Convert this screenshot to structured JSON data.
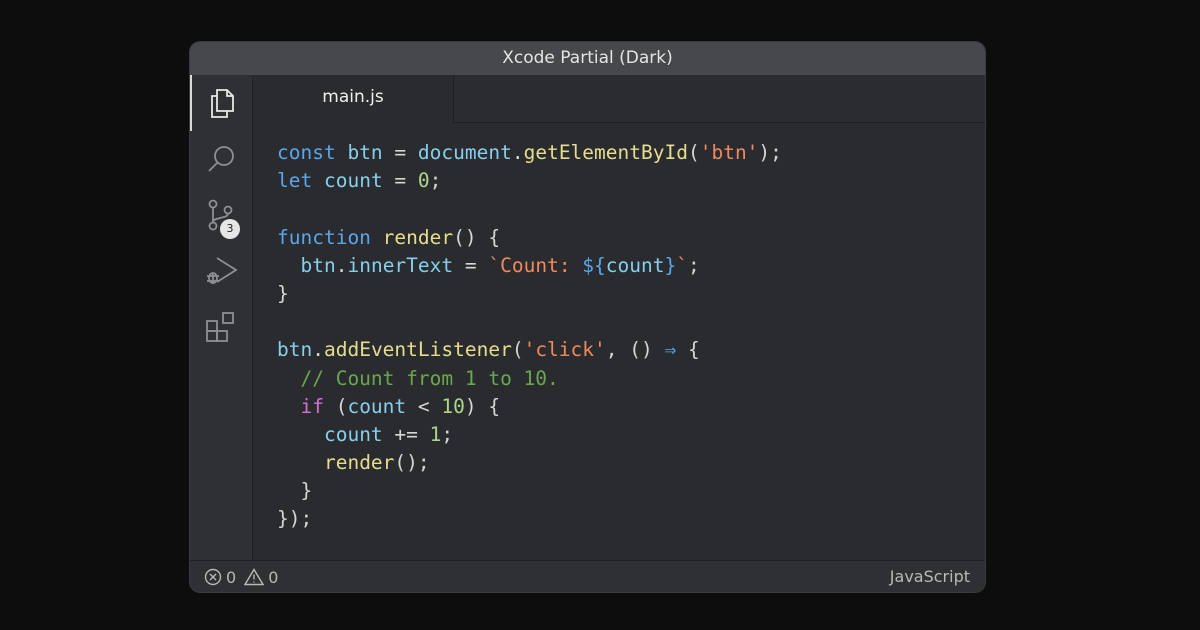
{
  "window": {
    "title": "Xcode Partial (Dark)"
  },
  "activity_bar": {
    "items": [
      {
        "icon": "files-icon",
        "active": true
      },
      {
        "icon": "search-icon",
        "active": false
      },
      {
        "icon": "source-control-icon",
        "active": false,
        "badge": "3"
      },
      {
        "icon": "run-debug-icon",
        "active": false
      },
      {
        "icon": "extensions-icon",
        "active": false
      }
    ]
  },
  "tabs": [
    {
      "label": "main.js",
      "active": true
    }
  ],
  "editor": {
    "language": "JavaScript",
    "lines": [
      [
        {
          "t": "const",
          "c": "kw"
        },
        {
          "t": " ",
          "c": "pl"
        },
        {
          "t": "btn",
          "c": "id"
        },
        {
          "t": " = ",
          "c": "pl"
        },
        {
          "t": "document",
          "c": "id"
        },
        {
          "t": ".",
          "c": "pl"
        },
        {
          "t": "getElementById",
          "c": "fn"
        },
        {
          "t": "(",
          "c": "pl"
        },
        {
          "t": "'btn'",
          "c": "str"
        },
        {
          "t": ");",
          "c": "pl"
        }
      ],
      [
        {
          "t": "let",
          "c": "kw"
        },
        {
          "t": " ",
          "c": "pl"
        },
        {
          "t": "count",
          "c": "id"
        },
        {
          "t": " = ",
          "c": "pl"
        },
        {
          "t": "0",
          "c": "num"
        },
        {
          "t": ";",
          "c": "pl"
        }
      ],
      [],
      [
        {
          "t": "function",
          "c": "kw"
        },
        {
          "t": " ",
          "c": "pl"
        },
        {
          "t": "render",
          "c": "fn"
        },
        {
          "t": "() {",
          "c": "pl"
        }
      ],
      [
        {
          "t": "  ",
          "c": "pl"
        },
        {
          "t": "btn",
          "c": "id"
        },
        {
          "t": ".",
          "c": "pl"
        },
        {
          "t": "innerText",
          "c": "id"
        },
        {
          "t": " = ",
          "c": "pl"
        },
        {
          "t": "`Count: ",
          "c": "str"
        },
        {
          "t": "${",
          "c": "kw"
        },
        {
          "t": "count",
          "c": "id"
        },
        {
          "t": "}",
          "c": "kw"
        },
        {
          "t": "`",
          "c": "str"
        },
        {
          "t": ";",
          "c": "pl"
        }
      ],
      [
        {
          "t": "}",
          "c": "pl"
        }
      ],
      [],
      [
        {
          "t": "btn",
          "c": "id"
        },
        {
          "t": ".",
          "c": "pl"
        },
        {
          "t": "addEventListener",
          "c": "fn"
        },
        {
          "t": "(",
          "c": "pl"
        },
        {
          "t": "'click'",
          "c": "str"
        },
        {
          "t": ", () ",
          "c": "pl"
        },
        {
          "t": "⇒",
          "c": "kw"
        },
        {
          "t": " {",
          "c": "pl"
        }
      ],
      [
        {
          "t": "  ",
          "c": "pl"
        },
        {
          "t": "// Count from 1 to 10.",
          "c": "cm"
        }
      ],
      [
        {
          "t": "  ",
          "c": "pl"
        },
        {
          "t": "if",
          "c": "ctl"
        },
        {
          "t": " (",
          "c": "pl"
        },
        {
          "t": "count",
          "c": "id"
        },
        {
          "t": " < ",
          "c": "pl"
        },
        {
          "t": "10",
          "c": "num"
        },
        {
          "t": ") {",
          "c": "pl"
        }
      ],
      [
        {
          "t": "    ",
          "c": "pl"
        },
        {
          "t": "count",
          "c": "id"
        },
        {
          "t": " += ",
          "c": "pl"
        },
        {
          "t": "1",
          "c": "num"
        },
        {
          "t": ";",
          "c": "pl"
        }
      ],
      [
        {
          "t": "    ",
          "c": "pl"
        },
        {
          "t": "render",
          "c": "fn"
        },
        {
          "t": "();",
          "c": "pl"
        }
      ],
      [
        {
          "t": "  }",
          "c": "pl"
        }
      ],
      [
        {
          "t": "});",
          "c": "pl"
        }
      ]
    ]
  },
  "status": {
    "errors": "0",
    "warnings": "0",
    "language": "JavaScript"
  }
}
